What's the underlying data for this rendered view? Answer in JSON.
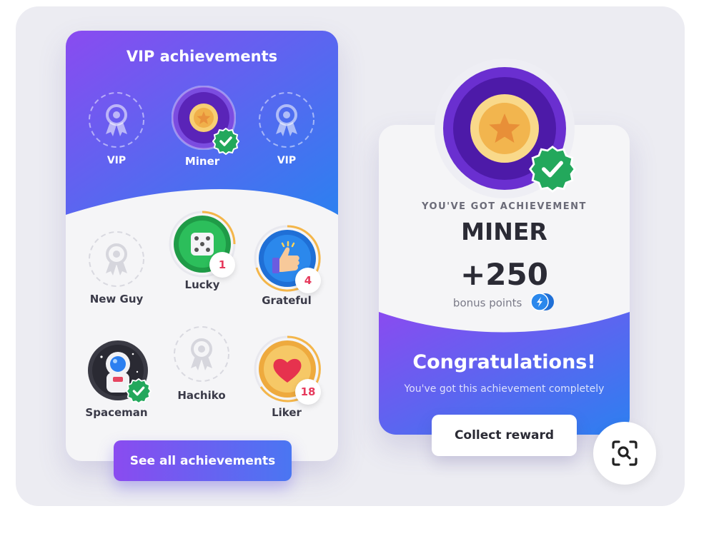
{
  "vip_card": {
    "title": "VIP achievements",
    "top_badges": [
      {
        "label": "VIP",
        "icon": "ribbon-badge-icon",
        "state": "locked"
      },
      {
        "label": "Miner",
        "icon": "star-coin-medal-icon",
        "state": "earned"
      },
      {
        "label": "VIP",
        "icon": "ribbon-badge-icon",
        "state": "locked"
      }
    ],
    "grid_badges": [
      {
        "label": "New Guy",
        "icon": "ribbon-badge-icon",
        "state": "locked",
        "count": ""
      },
      {
        "label": "Lucky",
        "icon": "dice-icon",
        "state": "progress",
        "count": "1"
      },
      {
        "label": "Grateful",
        "icon": "thumbs-up-icon",
        "state": "progress",
        "count": "4"
      },
      {
        "label": "Spaceman",
        "icon": "astronaut-icon",
        "state": "earned",
        "count": ""
      },
      {
        "label": "Hachiko",
        "icon": "ribbon-badge-icon",
        "state": "locked",
        "count": ""
      },
      {
        "label": "Liker",
        "icon": "heart-icon",
        "state": "progress",
        "count": "18"
      }
    ],
    "see_all_label": "See all achievements"
  },
  "reward_card": {
    "kicker": "YOU'VE GOT ACHIEVEMENT",
    "achievement_name": "MINER",
    "points": "+250",
    "bonus_label": "bonus points",
    "congrats_title": "Congratulations!",
    "congrats_subtitle": "You've got this achievement completely",
    "collect_label": "Collect reward"
  },
  "colors": {
    "purple": "#8a4bf0",
    "blue": "#2f7cf0",
    "success_green": "#23a85c",
    "count_red": "#e63a5c",
    "gold": "#f4c060"
  },
  "overlay": {
    "lens_icon": "visual-search-icon"
  }
}
